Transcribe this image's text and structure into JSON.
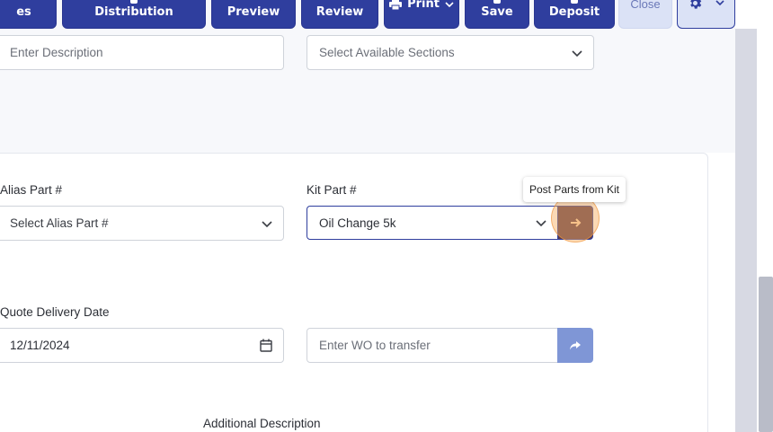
{
  "toolbar": {
    "partial_label": "es",
    "distribution_label": "Distribution",
    "preview_label": "Preview",
    "review_label": "Review",
    "print_label": "Print",
    "save_label": "Save",
    "deposit_label": "Deposit",
    "close_label": "Close",
    "settings_icon": "gear-icon"
  },
  "form": {
    "description_placeholder": "Enter Description",
    "sections_placeholder": "Select Available Sections",
    "alias_part_label": "Alias Part #",
    "alias_part_placeholder": "Select Alias Part #",
    "kit_part_label": "Kit Part #",
    "kit_part_value": "Oil Change 5k",
    "post_parts_tooltip": "Post Parts from Kit",
    "quote_delivery_label": "Quote Delivery Date",
    "quote_delivery_value": "12/11/2024",
    "transfer_placeholder": "Enter WO to transfer",
    "additional_description_label": "Additional Description"
  },
  "colors": {
    "primary": "#2f3e9e",
    "light_button": "#dbe2f6",
    "transfer_button": "#7f96d6",
    "post_button": "#5a3b4d"
  }
}
